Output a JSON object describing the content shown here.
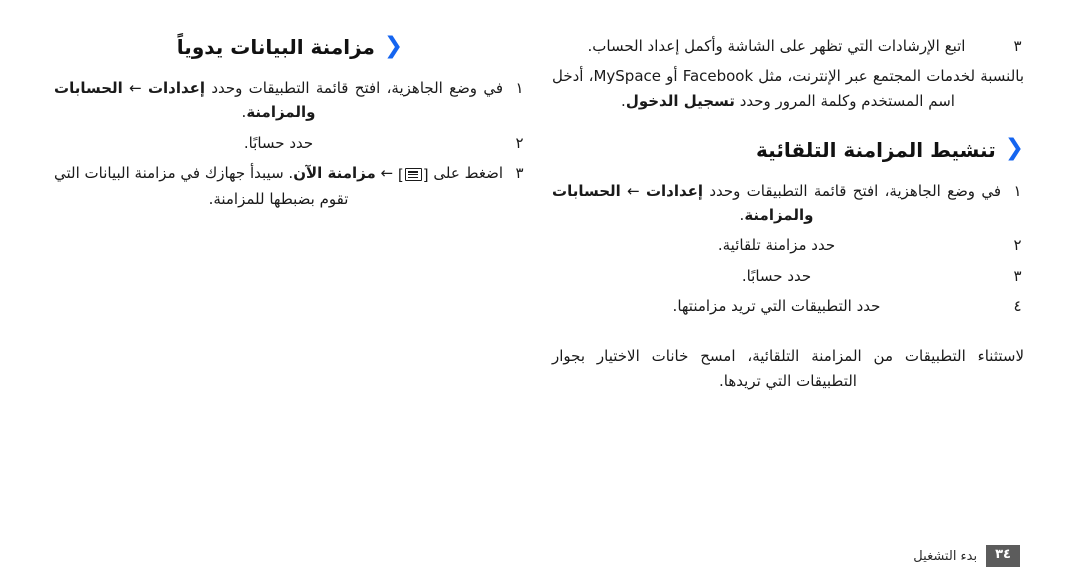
{
  "document": {
    "language": "ar",
    "direction": "rtl"
  },
  "columns": {
    "right": {
      "step3_number": "٣",
      "step3_text": "اتبع الإرشادات التي تظهر على الشاشة وأكمل إعداد الحساب.",
      "note_part1": "بالنسبة لخدمات المجتمع عبر الإنترنت، مثل ",
      "note_brand1": "Facebook",
      "note_part2": " أو ",
      "note_brand2": "MySpace",
      "note_part3": "، أدخل اسم المستخدم وكلمة المرور وحدد ",
      "note_bold": "تسجيل الدخول",
      "note_part4": ".",
      "heading": {
        "chevron": "❮",
        "title": "تنشيط المزامنة التلقائية"
      },
      "steps": [
        {
          "number": "١",
          "text_before": "في وضع الجاهزية، افتح قائمة التطبيقات وحدد ",
          "bold1": "إعدادات",
          "arrow": " ← ",
          "bold2": "الحسابات والمزامنة",
          "text_after": "."
        },
        {
          "number": "٢",
          "text": "حدد مزامنة تلقائية."
        },
        {
          "number": "٣",
          "text": "حدد حسابًا."
        },
        {
          "number": "٤",
          "text": "حدد التطبيقات التي تريد مزامنتها."
        }
      ],
      "closing_paragraph": "لاستثناء التطبيقات من المزامنة التلقائية، امسح خانات الاختيار بجوار التطبيقات التي تريدها."
    },
    "left": {
      "heading": {
        "chevron": "❮",
        "title": "مزامنة البيانات يدوياً"
      },
      "steps": [
        {
          "number": "١",
          "text_before": "في وضع الجاهزية، افتح قائمة التطبيقات وحدد ",
          "bold1": "إعدادات",
          "arrow": " ← ",
          "bold2": "الحسابات والمزامنة",
          "text_after": "."
        },
        {
          "number": "٢",
          "text": "حدد حسابًا."
        },
        {
          "number": "٣",
          "text_before": "اضغط على ",
          "menu_key": "[≡]",
          "arrow": " ← ",
          "bold": "مزامنة الآن",
          "text_after": ". سيبدأ جهازك في مزامنة البيانات التي تقوم بضبطها للمزامنة."
        }
      ]
    }
  },
  "footer": {
    "page_number": "٣٤",
    "section_label": "بدء التشغيل"
  },
  "colors": {
    "chevron_blue": "#1565f0",
    "page_number_background": "#5c5c5c",
    "text": "#1a1a1a",
    "page_background": "#ffffff"
  }
}
